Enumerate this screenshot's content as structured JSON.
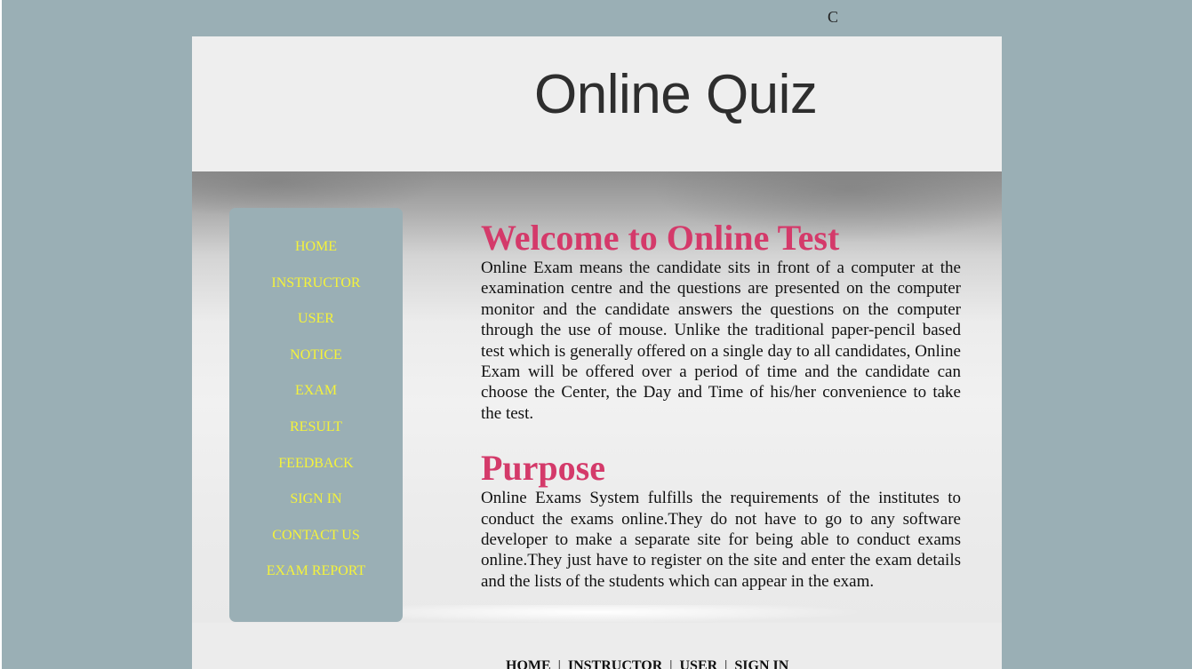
{
  "corner_char": "C",
  "header": {
    "title": "Online Quiz"
  },
  "sidebar": {
    "items": [
      {
        "label": "HOME"
      },
      {
        "label": "INSTRUCTOR"
      },
      {
        "label": "USER"
      },
      {
        "label": "NOTICE"
      },
      {
        "label": "EXAM"
      },
      {
        "label": "RESULT"
      },
      {
        "label": "FEEDBACK"
      },
      {
        "label": "SIGN IN"
      },
      {
        "label": "CONTACT US"
      },
      {
        "label": "EXAM REPORT"
      }
    ]
  },
  "main": {
    "welcome_heading": "Welcome to Online Test",
    "welcome_text": "Online Exam means the candidate sits in front of a computer at the examination centre and the questions are presented on the computer monitor and the candidate answers the questions on the computer through the use of mouse. Unlike the traditional paper-pencil based test which is generally offered on a single day to all candidates, Online Exam will be offered over a period of time and the candidate can choose the Center, the Day and Time of his/her convenience to take the test.",
    "purpose_heading": "Purpose",
    "purpose_text": "Online Exams System fulfills the requirements of the institutes to conduct the exams online.They do not have to go to any software developer to make a separate site for being able to conduct exams online.They just have to register on the site and enter the exam details and the lists of the students which can appear in the exam."
  },
  "footer": {
    "links": [
      {
        "label": "HOME"
      },
      {
        "label": "INSTRUCTOR"
      },
      {
        "label": "USER"
      },
      {
        "label": "SIGN IN"
      }
    ],
    "separator": "|"
  },
  "colors": {
    "background": "#9aafb5",
    "sidebar_bg": "#9aafb5",
    "nav_link": "#f5f33a",
    "heading": "#d43a6a",
    "title": "#2e2e2e"
  }
}
